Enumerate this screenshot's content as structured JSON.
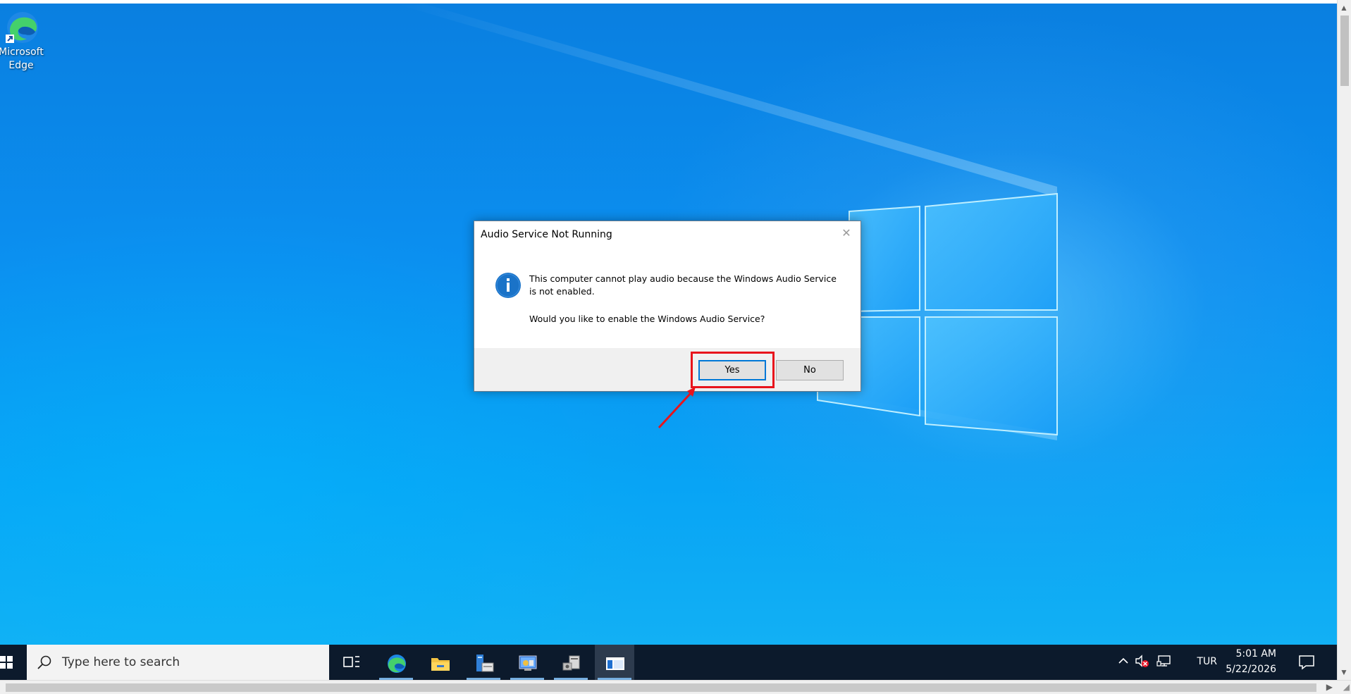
{
  "desktop": {
    "icons": [
      {
        "label": "Microsoft\nEdge",
        "icon": "edge-icon"
      }
    ]
  },
  "dialog": {
    "title": "Audio Service Not Running",
    "message_line1": "This computer cannot play audio because the Windows Audio Service is not enabled.",
    "message_line2": "Would you like to enable the Windows Audio Service?",
    "yes_label": "Yes",
    "no_label": "No",
    "close_icon": "close-icon",
    "info_icon": "info-icon"
  },
  "annotation": {
    "color": "#e8141c",
    "target": "Yes"
  },
  "taskbar": {
    "search_placeholder": "Type here to search",
    "items": [
      {
        "name": "task-view",
        "icon": "task-view-icon"
      },
      {
        "name": "edge",
        "icon": "edge-icon"
      },
      {
        "name": "file-explorer",
        "icon": "folder-icon"
      },
      {
        "name": "server-manager",
        "icon": "server-manager-icon"
      },
      {
        "name": "network-app",
        "icon": "network-icon"
      },
      {
        "name": "tool-app",
        "icon": "tools-icon"
      },
      {
        "name": "active-window",
        "icon": "window-icon"
      }
    ],
    "tray": {
      "language": "TUR",
      "time": "5:01 AM",
      "date": "5/22/2026",
      "icons": [
        "chevron-up-icon",
        "speaker-muted-icon",
        "network-icon",
        "notification-icon"
      ]
    }
  },
  "colors": {
    "desktop_blue": "#0b8ff0",
    "taskbar": "#0c1a2c",
    "dialog_button_focus": "#0078d7",
    "info_blue": "#1a73c8"
  }
}
